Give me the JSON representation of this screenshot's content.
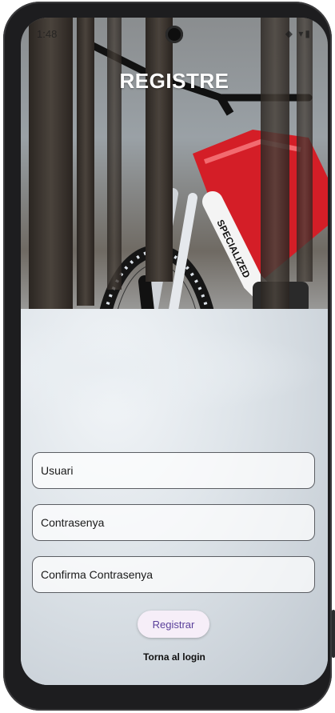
{
  "status_bar": {
    "time": "1:48",
    "icons": "◆ ▾▮"
  },
  "screen": {
    "title": "REGISTRE"
  },
  "form": {
    "username_label": "Usuari",
    "password_label": "Contrasenya",
    "confirm_label": "Confirma Contrasenya"
  },
  "actions": {
    "register_label": "Registrar",
    "back_to_login_label": "Torna al login"
  },
  "background": {
    "description_icon": "snowy-bike-photo"
  }
}
